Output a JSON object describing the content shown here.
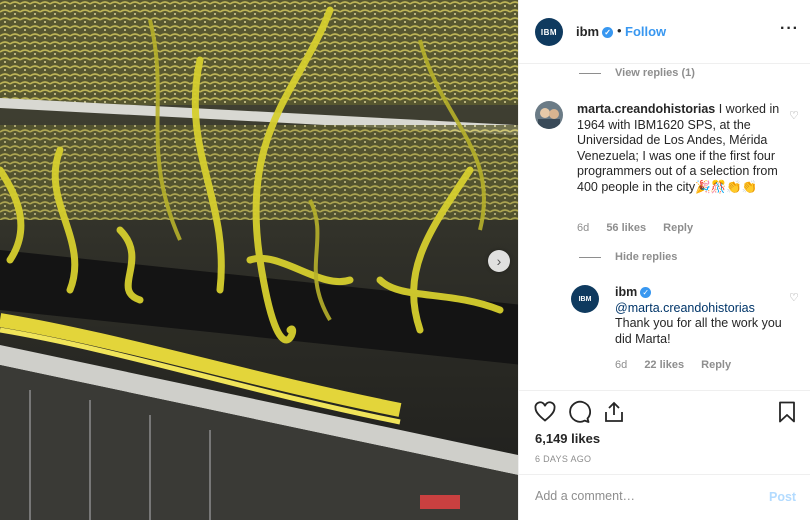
{
  "post": {
    "image_alt": "",
    "carousel_next_icon": "chevron-right-icon"
  },
  "header": {
    "avatar_text": "IBM",
    "username": "ibm",
    "verified_icon": "verified-badge-icon",
    "separator": "•",
    "follow_label": "Follow",
    "more_icon": "more-options-icon",
    "more_glyph": "···"
  },
  "thread": {
    "view_replies_label": "View replies (1)",
    "comment": {
      "username": "marta.creandohistorias",
      "text": "I worked in 1964 with IBM1620 SPS, at the Universidad de Los Andes, Mérida Venezuela; I was one if the first four programmers out of a selection from 400 people in the city🎉🎊👏👏",
      "age": "6d",
      "likes": "56 likes",
      "reply_label": "Reply"
    },
    "hide_replies_label": "Hide replies",
    "reply": {
      "username": "ibm",
      "mention": "@marta.creandohistorias",
      "text": "Thank you for all the work you did Marta!",
      "age": "6d",
      "likes": "22 likes",
      "reply_label": "Reply"
    }
  },
  "actions": {
    "like_icon": "heart-icon",
    "comment_icon": "comment-icon",
    "share_icon": "share-icon",
    "save_icon": "bookmark-icon",
    "likes_count": "6,149 likes",
    "date": "6 DAYS AGO"
  },
  "add_comment": {
    "placeholder": "Add a comment…",
    "post_label": "Post"
  },
  "colors": {
    "accent": "#3897f0",
    "post_disabled": "#b3dbff",
    "muted": "#8e8e8e"
  }
}
